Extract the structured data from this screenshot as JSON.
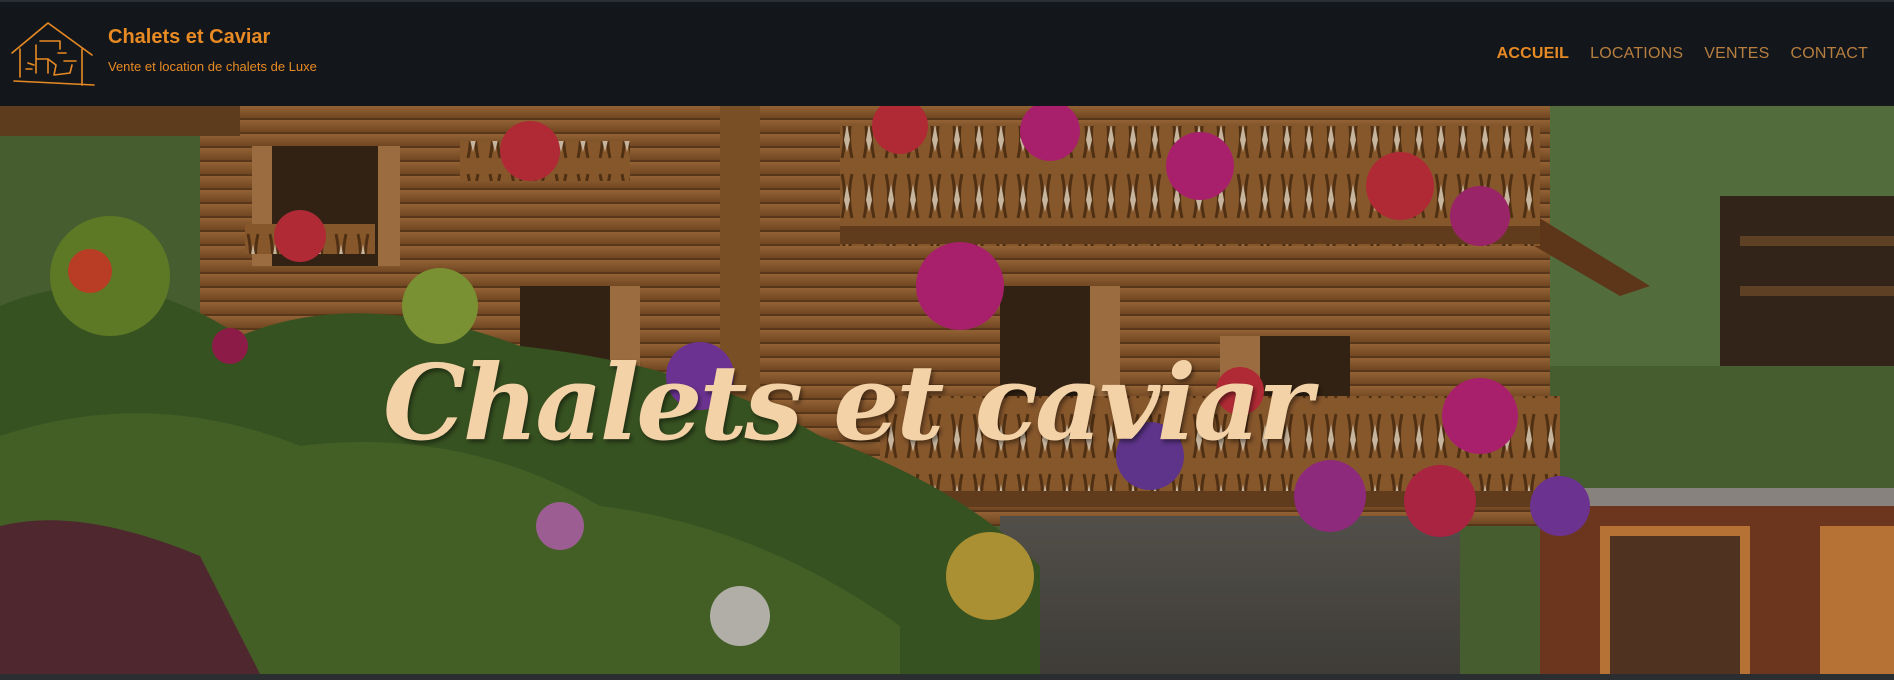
{
  "brand": {
    "name": "Chalets et Caviar",
    "tagline": "Vente et location de chalets de Luxe",
    "logo_icon": "chalet-logo-icon"
  },
  "nav": {
    "items": [
      {
        "label": "ACCUEIL",
        "active": true
      },
      {
        "label": "LOCATIONS",
        "active": false
      },
      {
        "label": "VENTES",
        "active": false
      },
      {
        "label": "CONTACT",
        "active": false
      }
    ]
  },
  "hero": {
    "title": "Chalets et caviar"
  },
  "colors": {
    "accent": "#e88a23",
    "nav_background": "#13171c",
    "hero_title": "#f3d2a7"
  }
}
